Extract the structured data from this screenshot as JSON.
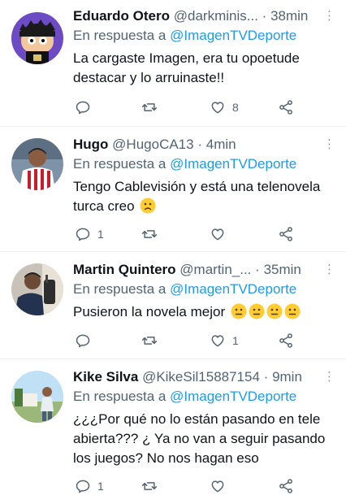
{
  "tweets": [
    {
      "name": "Eduardo Otero",
      "handle": "@darkminis...",
      "dot": "·",
      "time": "38min",
      "reply_prefix": "En respuesta a",
      "reply_to": "@ImagenTVDeporte",
      "text": "La cargaste Imagen, era tu opoetude destacar y lo arruinaste!!",
      "reply_count": "",
      "retweet_count": "",
      "like_count": "8",
      "avatar": "avatar-cartoon"
    },
    {
      "name": "Hugo",
      "handle": "@HugoCA13",
      "dot": "·",
      "time": "4min",
      "reply_prefix": "En respuesta a",
      "reply_to": "@ImagenTVDeporte",
      "text": "Tengo Cablevisión y está una telenovela turca creo",
      "emoji": "frowning-face-emoji",
      "reply_count": "1",
      "retweet_count": "",
      "like_count": "",
      "avatar": "avatar-photo"
    },
    {
      "name": "Martin Quintero",
      "handle": "@martin_...",
      "dot": "·",
      "time": "35min",
      "reply_prefix": "En respuesta a",
      "reply_to": "@ImagenTVDeporte",
      "text": "Pusieron la novela mejor",
      "emoji": "neutral-face-emoji x4",
      "reply_count": "",
      "retweet_count": "",
      "like_count": "1",
      "avatar": "avatar-photo"
    },
    {
      "name": "Kike Silva",
      "handle": "@KikeSil15887154",
      "dot": "·",
      "time": "9min",
      "reply_prefix": "En respuesta a",
      "reply_to": "@ImagenTVDeporte",
      "text": "¿¿¿Por qué no lo están pasando en tele abierta??? ¿ Ya no van a seguir pasando los juegos? No nos hagan eso",
      "reply_count": "1",
      "retweet_count": "",
      "like_count": "",
      "avatar": "avatar-photo"
    }
  ],
  "icons": {
    "reply": "reply-icon",
    "retweet": "retweet-icon",
    "like": "heart-icon",
    "share": "share-icon",
    "more": "more-icon"
  },
  "colors": {
    "link": "#1d9bf0",
    "secondary": "#536471",
    "divider": "#eff3f4"
  }
}
